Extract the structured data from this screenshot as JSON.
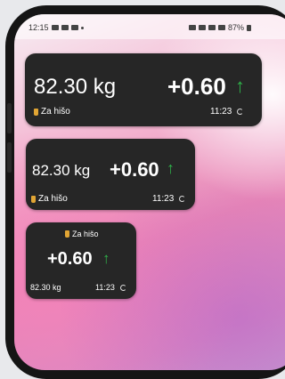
{
  "status_bar": {
    "time": "12:15",
    "battery": "87%"
  },
  "widgets": [
    {
      "weight": "82.30 kg",
      "change": "+0.60",
      "arrow": "↑",
      "label": "Za hišo",
      "time": "11:23"
    },
    {
      "weight": "82.30 kg",
      "change": "+0.60",
      "arrow": "↑",
      "label": "Za hišo",
      "time": "11:23"
    },
    {
      "weight": "82.30 kg",
      "change": "+0.60",
      "arrow": "↑",
      "label": "Za hišo",
      "time": "11:23"
    }
  ],
  "colors": {
    "card_bg": "#262626",
    "increase_arrow": "#2fb34a",
    "label_icon": "#e1a534"
  },
  "icons": [
    "shopping-bag-icon",
    "refresh-icon",
    "up-arrow-icon",
    "battery-icon",
    "wifi-icon",
    "signal-icon"
  ]
}
